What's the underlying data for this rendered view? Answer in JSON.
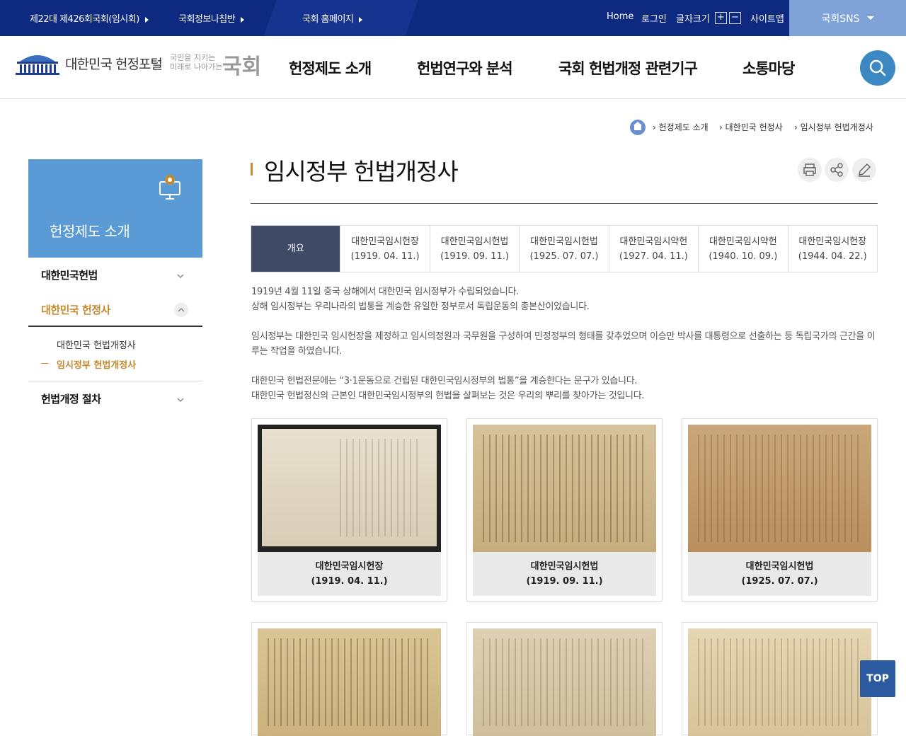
{
  "topbar": {
    "links": [
      "제22대 제426회국회(임시회)",
      "국회정보나침반",
      "국회 홈페이지"
    ],
    "home": "Home",
    "login": "로그인",
    "font_size": "글자크기",
    "font_plus": "+",
    "font_minus": "−",
    "sitemap": "사이트맵",
    "sns": "국회SNS"
  },
  "header": {
    "logo_title": "대한민국 헌정포털",
    "slogan_line1": "국민을 지키는",
    "slogan_line2": "미래로 나아가는",
    "slogan_brand": "국회",
    "gnb": [
      "헌정제도 소개",
      "헌법연구와 분석",
      "국회 헌법개정 관련기구",
      "소통마당"
    ]
  },
  "breadcrumb": [
    "헌정제도 소개",
    "대한민국 헌정사",
    "임시정부 헌법개정사"
  ],
  "lnb": {
    "title": "헌정제도 소개",
    "items": [
      "대한민국헌법",
      "대한민국 헌정사",
      "헌법개정 절차"
    ],
    "subitems": [
      "대한민국 헌법개정사",
      "임시정부 헌법개정사"
    ]
  },
  "page": {
    "title": "임시정부 헌법개정사",
    "tabs": [
      {
        "name": "개요",
        "date": ""
      },
      {
        "name": "대한민국임시헌장",
        "date": "(1919. 04. 11.)"
      },
      {
        "name": "대한민국임시헌법",
        "date": "(1919. 09. 11.)"
      },
      {
        "name": "대한민국임시헌법",
        "date": "(1925. 07. 07.)"
      },
      {
        "name": "대한민국임시약헌",
        "date": "(1927. 04. 11.)"
      },
      {
        "name": "대한민국임시약헌",
        "date": "(1940. 10. 09.)"
      },
      {
        "name": "대한민국임시헌장",
        "date": "(1944. 04. 22.)"
      }
    ],
    "paragraphs": [
      "1919년 4월 11일 중국 상해에서 대한민국 임시정부가 수립되었습니다.",
      "상해 임시정부는 우리나라의 법통을 계승한 유일한 정부로서 독립운동의 총본산이었습니다.",
      "임시정부는 대한민국 임시헌장을 제정하고 임시의정원과 국무원을 구성하여 민정정부의 형태를 갖추었으며 이승만 박사를 대통령으로 선출하는 등 독립국가의 근간을 이루는 작업을 하였습니다.",
      "대한민국 헌법전문에는 “3·1운동으로 건립된 대한민국임시정부의 법통”을 계승한다는 문구가 있습니다.",
      "대한민국 헌법정신의 근본인 대한민국임시정부의 헌법을 살펴보는 것은 우리의 뿌리를 찾아가는 것입니다."
    ],
    "cards": [
      {
        "name": "대한민국임시헌장",
        "date": "(1919. 04. 11.)"
      },
      {
        "name": "대한민국임시헌법",
        "date": "(1919. 09. 11.)"
      },
      {
        "name": "대한민국임시헌법",
        "date": "(1925. 07. 07.)"
      }
    ]
  },
  "top_button": "TOP"
}
